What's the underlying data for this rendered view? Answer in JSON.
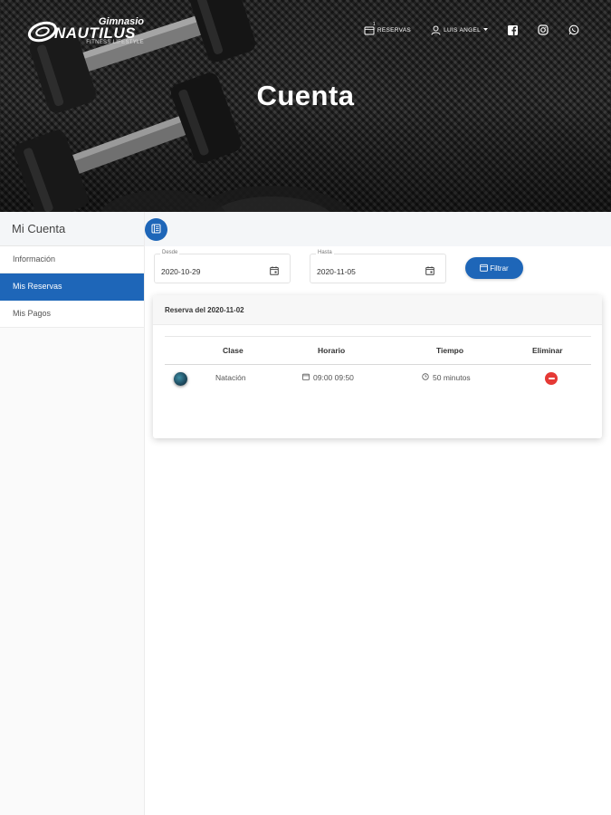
{
  "brand": {
    "name_top": "Gimnasio",
    "name_main": "NAUTILUS",
    "tagline": "FITNESS LIFESTYLE"
  },
  "nav": {
    "reservas_label": "RESERVAS",
    "reservas_badge": "1",
    "user_label": "LUIS ANGEL",
    "social_icons": [
      "facebook-icon",
      "instagram-icon",
      "whatsapp-icon"
    ]
  },
  "hero": {
    "title": "Cuenta"
  },
  "sidebar": {
    "title": "Mi Cuenta",
    "items": [
      {
        "label": "Información",
        "active": false
      },
      {
        "label": "Mis Reservas",
        "active": true
      },
      {
        "label": "Mis Pagos",
        "active": false
      }
    ]
  },
  "filters": {
    "from_label": "Desde",
    "from_value": "2020-10-29",
    "to_label": "Hasta",
    "to_value": "2020-11-05",
    "filter_button": "Filtrar"
  },
  "reservation": {
    "header": "Reserva del 2020-11-02",
    "columns": [
      "Clase",
      "Horario",
      "Tiempo",
      "Eliminar"
    ],
    "rows": [
      {
        "clase": "Natación",
        "horario": "09:00 09:50",
        "tiempo": "50 minutos"
      }
    ]
  },
  "colors": {
    "primary": "#1e66b8",
    "danger": "#e53935",
    "sidebar_active": "#1e66b8"
  }
}
